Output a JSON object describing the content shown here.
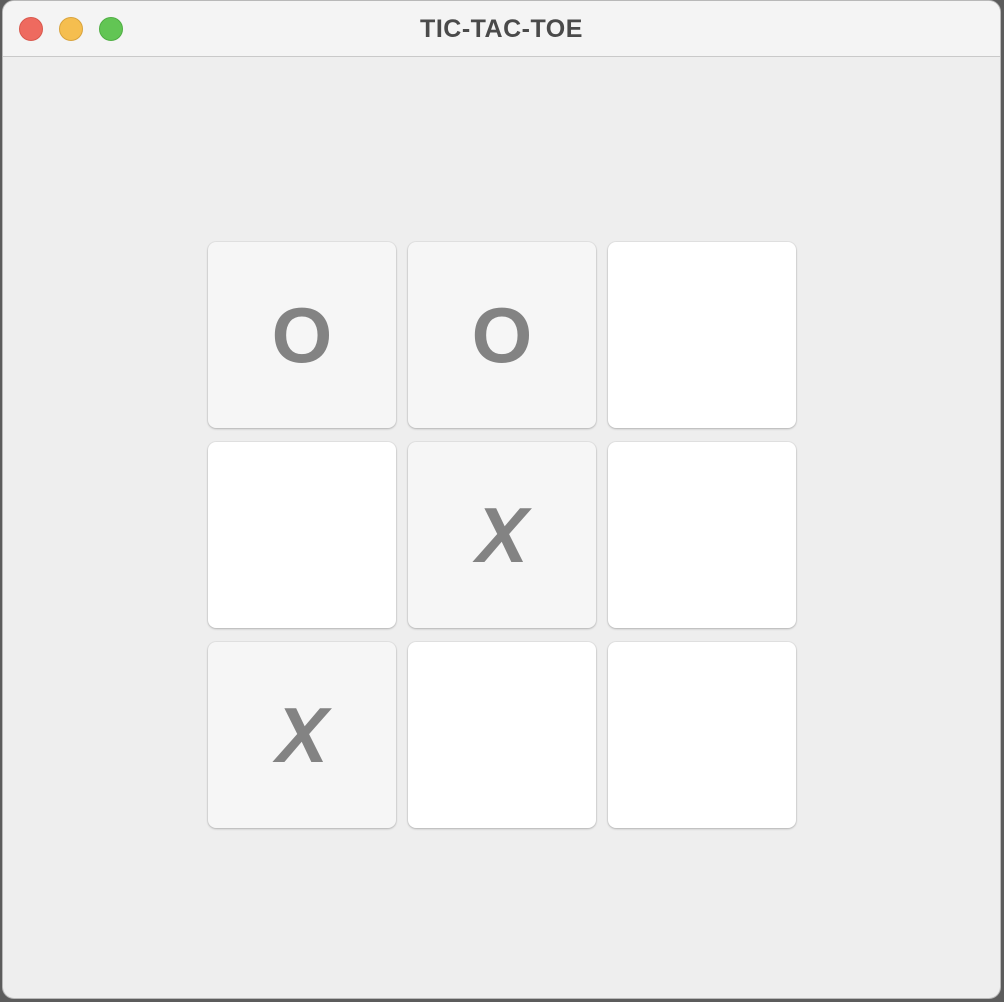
{
  "window": {
    "title": "TIC-TAC-TOE",
    "controls": {
      "close_color": "#ee6a5f",
      "minimize_color": "#f5be4f",
      "zoom_color": "#62c554"
    }
  },
  "board": {
    "cells": [
      "O",
      "O",
      "",
      "",
      "X",
      "",
      "X",
      "",
      ""
    ]
  }
}
